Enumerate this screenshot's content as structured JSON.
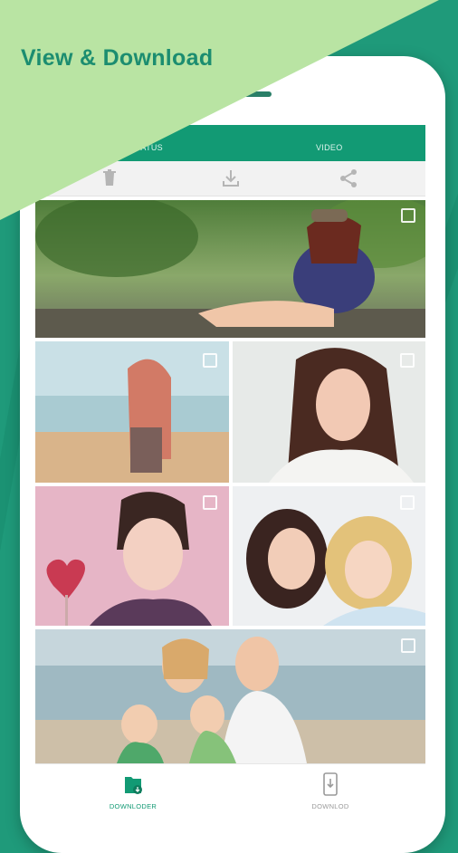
{
  "promo": {
    "headline": "View & Download"
  },
  "tabs": [
    {
      "label": "STATUS"
    },
    {
      "label": "VIDEO"
    }
  ],
  "toolbar": {
    "delete_icon": "trash-icon",
    "download_icon": "download-icon",
    "share_icon": "share-icon"
  },
  "gallery": {
    "items": [
      {
        "name": "girl-hat-park",
        "selected": false
      },
      {
        "name": "girl-beach",
        "selected": false
      },
      {
        "name": "girl-portrait",
        "selected": false
      },
      {
        "name": "girl-heart",
        "selected": false
      },
      {
        "name": "friends-lying",
        "selected": false
      },
      {
        "name": "family-beach",
        "selected": false
      }
    ]
  },
  "bottom_nav": {
    "downloader": {
      "label": "DOWNLODER",
      "active": true
    },
    "download": {
      "label": "DOWNLOD",
      "active": false
    }
  },
  "colors": {
    "accent": "#129a74",
    "background": "#1f9a7a",
    "promo_band": "#b9e4a3",
    "headline": "#1c8d70"
  }
}
